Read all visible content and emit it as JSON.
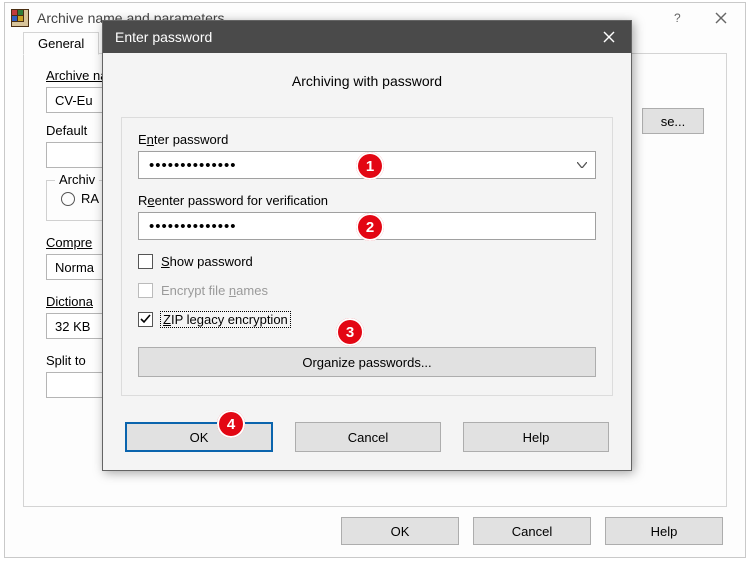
{
  "bg": {
    "title": "Archive name and parameters",
    "tab": "General",
    "archive_label": "Archive name",
    "archive_value": "CV-Eu",
    "browse_label": "se...",
    "profile_label": "Default",
    "format_group": "Archiv",
    "format_rar": "RA",
    "compression_label": "Compre",
    "compression_value": "Norma",
    "dictionary_label": "Dictiona",
    "dictionary_value": "32 KB",
    "split_label": "Split to",
    "ok": "OK",
    "cancel": "Cancel",
    "help": "Help"
  },
  "modal": {
    "title": "Enter password",
    "heading": "Archiving with password",
    "enter_label_pre": "E",
    "enter_label_ul": "n",
    "enter_label_post": "ter password",
    "pw1_masked": "••••••••••••••",
    "reenter_label_pre": "R",
    "reenter_label_ul": "e",
    "reenter_label_post": "enter password for verification",
    "pw2_masked": "••••••••••••••",
    "show_pre": "",
    "show_ul": "S",
    "show_post": "how password",
    "encrypt_pre": "Encrypt file ",
    "encrypt_ul": "n",
    "encrypt_post": "ames",
    "zip_pre": "",
    "zip_ul": "Z",
    "zip_post": "IP legacy encryption",
    "organize_pre": "",
    "organize_ul": "O",
    "organize_post": "rganize passwords...",
    "ok": "OK",
    "cancel": "Cancel",
    "help": "Help",
    "show_checked": false,
    "encrypt_enabled": false,
    "encrypt_checked": false,
    "zip_checked": true
  },
  "annotations": {
    "a1": "1",
    "a2": "2",
    "a3": "3",
    "a4": "4"
  }
}
